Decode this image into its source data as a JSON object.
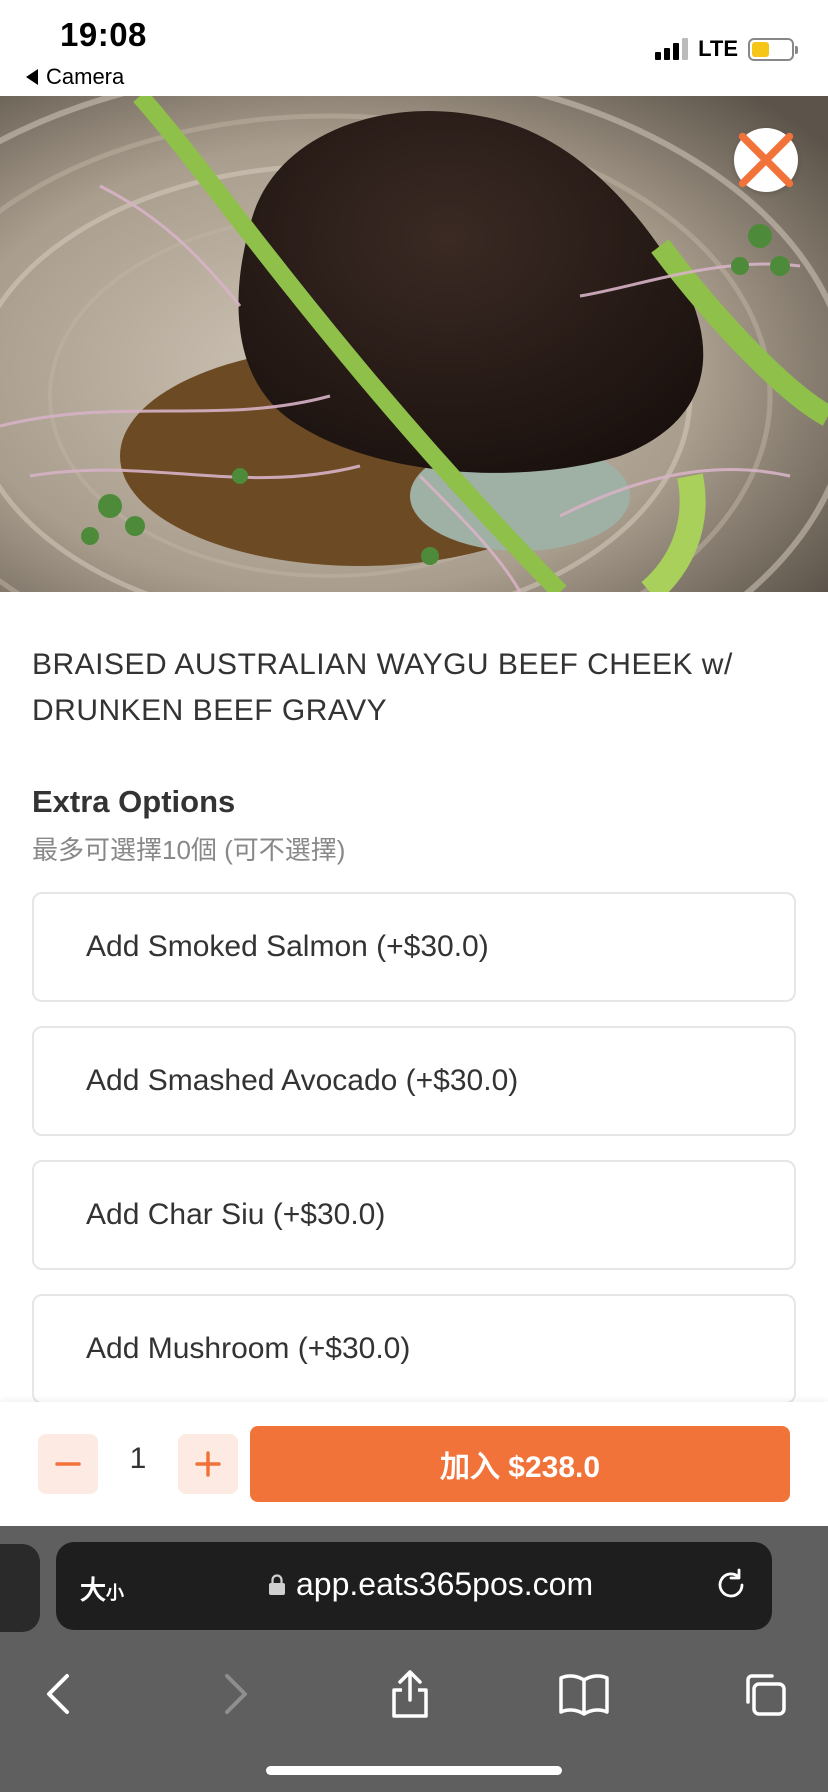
{
  "status_bar": {
    "time": "19:08",
    "back_app": "Camera",
    "network": "LTE",
    "battery_level": 0.45
  },
  "hero": {
    "close_icon": "close-icon",
    "accent": "#f2733a"
  },
  "dish": {
    "title": "BRAISED AUSTRALIAN WAYGU BEEF CHEEK w/ DRUNKEN BEEF GRAVY"
  },
  "extra_options": {
    "title": "Extra Options",
    "subtitle": "最多可選擇10個 (可不選擇)",
    "items": [
      {
        "label": "Add Smoked Salmon (+$30.0)"
      },
      {
        "label": "Add Smashed Avocado (+$30.0)"
      },
      {
        "label": "Add Char Siu (+$30.0)"
      },
      {
        "label": "Add Mushroom (+$30.0)"
      }
    ]
  },
  "cart": {
    "quantity": "1",
    "add_label": "加入 $238.0",
    "decrement_icon": "minus-icon",
    "increment_icon": "plus-icon"
  },
  "browser": {
    "text_size_label": "大",
    "text_size_small": "小",
    "url": "app.eats365pos.com"
  }
}
